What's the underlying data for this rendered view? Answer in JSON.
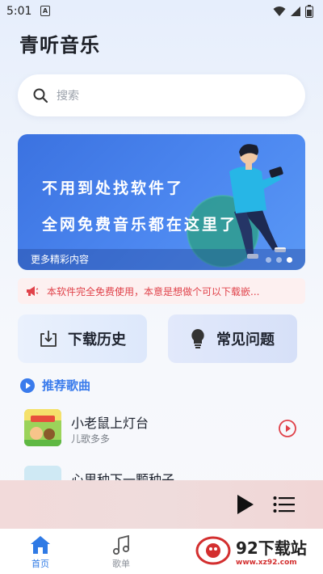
{
  "status_bar": {
    "time": "5:01",
    "notif_letter": "A"
  },
  "app": {
    "title": "青听音乐"
  },
  "search": {
    "placeholder": "搜索"
  },
  "banner": {
    "line1": "不用到处找软件了",
    "line2": "全网免费音乐都在这里了",
    "caption": "更多精彩内容",
    "slides": 3,
    "active_slide": 3
  },
  "notice": {
    "text": "本软件完全免费使用，本意是想做个可以下载嵌..."
  },
  "quick_actions": [
    {
      "label": "下载历史",
      "icon": "download-history-icon"
    },
    {
      "label": "常见问题",
      "icon": "lightbulb-icon"
    }
  ],
  "recommended": {
    "title": "推荐歌曲",
    "songs": [
      {
        "title": "小老鼠上灯台",
        "artist": "儿歌多多"
      },
      {
        "title": "心里种下一颗种子",
        "artist": ""
      }
    ]
  },
  "tabs": [
    {
      "label": "首页",
      "active": true,
      "icon": "home-icon"
    },
    {
      "label": "歌单",
      "active": false,
      "icon": "music-note-icon"
    }
  ],
  "watermark": {
    "title": "92下载站",
    "url": "www.xz92.com"
  },
  "colors": {
    "accent": "#3a7bec",
    "notice_red": "#e0424a",
    "banner_blue": "#4c87f0"
  }
}
